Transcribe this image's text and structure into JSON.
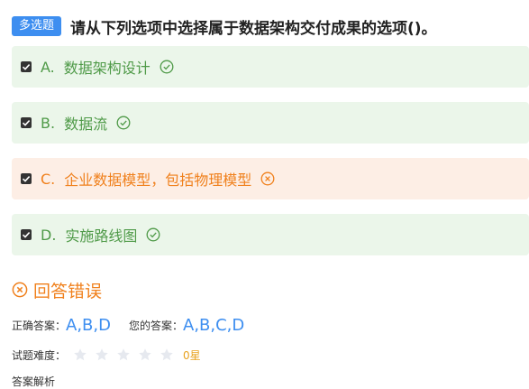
{
  "question": {
    "type_label": "多选题",
    "text": "请从下列选项中选择属于数据架构交付成果的选项()。"
  },
  "options": [
    {
      "letter": "A.",
      "text": "数据架构设计",
      "checked": true,
      "status": "correct"
    },
    {
      "letter": "B.",
      "text": "数据流",
      "checked": true,
      "status": "correct"
    },
    {
      "letter": "C.",
      "text": "企业数据模型，包括物理模型",
      "checked": true,
      "status": "wrong"
    },
    {
      "letter": "D.",
      "text": "实施路线图",
      "checked": true,
      "status": "correct"
    }
  ],
  "result": {
    "icon": "close-circle-icon",
    "text": "回答错误"
  },
  "answers": {
    "correct_label": "正确答案：",
    "correct_value": "A,B,D",
    "user_label": "您的答案：",
    "user_value": "A,B,C,D"
  },
  "difficulty": {
    "label": "试题难度：",
    "stars_filled": 0,
    "stars_total": 5,
    "rating_text": "0星"
  },
  "analysis": {
    "label": "答案解析"
  },
  "colors": {
    "accent_blue": "#3d8ef0",
    "correct_green": "#4f9a48",
    "correct_bg": "#ebf6ea",
    "wrong_orange": "#f0801c",
    "wrong_bg": "#fdeee5",
    "star_empty": "#e6e9ef",
    "star_text": "#e8a321"
  }
}
